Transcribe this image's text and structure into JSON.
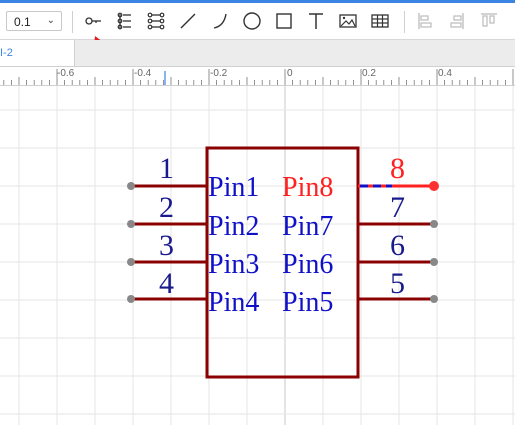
{
  "toolbar": {
    "grid_size": "0.1",
    "tools": [
      {
        "name": "pin-tool",
        "icon": "pin-icon"
      },
      {
        "name": "bus-tool",
        "icon": "pin-group-icon"
      },
      {
        "name": "multi-pin-tool",
        "icon": "pin-array-icon"
      },
      {
        "name": "line-tool",
        "icon": "line-icon"
      },
      {
        "name": "arc-tool",
        "icon": "arc-icon"
      },
      {
        "name": "circle-tool",
        "icon": "circle-icon"
      },
      {
        "name": "rectangle-tool",
        "icon": "rectangle-icon"
      },
      {
        "name": "text-tool",
        "icon": "text-icon"
      },
      {
        "name": "image-tool",
        "icon": "image-icon"
      },
      {
        "name": "table-tool",
        "icon": "table-icon"
      },
      {
        "name": "align-left-tool",
        "icon": "align-left-icon"
      },
      {
        "name": "align-right-tool",
        "icon": "align-right-icon"
      },
      {
        "name": "align-top-tool",
        "icon": "align-top-icon"
      }
    ],
    "accent_color": "#3b84e4"
  },
  "tab": {
    "label": "I-2"
  },
  "ruler": {
    "labels": [
      "-0.6",
      "-0.4",
      "-0.2",
      "0",
      "0.2",
      "0.4"
    ]
  },
  "symbol": {
    "body_color": "#8b0000",
    "name_color": "#1010c8",
    "selected_color": "#ff2020",
    "left_pins": [
      {
        "number": "1",
        "name": "Pin1"
      },
      {
        "number": "2",
        "name": "Pin2"
      },
      {
        "number": "3",
        "name": "Pin3"
      },
      {
        "number": "4",
        "name": "Pin4"
      }
    ],
    "right_pins": [
      {
        "number": "8",
        "name": "Pin8",
        "selected": true
      },
      {
        "number": "7",
        "name": "Pin7",
        "selected": false
      },
      {
        "number": "6",
        "name": "Pin6",
        "selected": false
      },
      {
        "number": "5",
        "name": "Pin5",
        "selected": false
      }
    ]
  }
}
